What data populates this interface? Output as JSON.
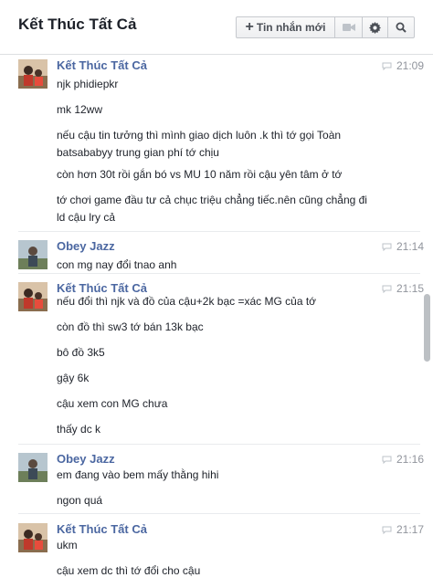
{
  "header": {
    "title": "Kết Thúc Tất Cả",
    "new_message_label": "Tin nhắn mới",
    "icons": [
      "plus-icon",
      "video-icon",
      "gear-icon",
      "search-icon"
    ]
  },
  "colors": {
    "sender": "#4b67a1",
    "time": "#90949c",
    "text": "#1d2129"
  },
  "groups": [
    {
      "sender": "Kết Thúc Tất Cả",
      "time": "21:09",
      "messages": [
        "njk phidiepkr",
        "mk 12ww",
        "nếu cậu tin tưởng thì mình giao dịch luôn .k thì tớ gọi Toàn batsababyy trung gian phí tớ chịu",
        "còn hơn 30t rồi gắn bó vs MU 10 năm rồi cậu yên tâm ở tớ",
        "tớ chơi game đầu tư cả chục triệu chẳng tiếc.nên cũng chẳng đi ld cậu lry cả"
      ]
    },
    {
      "sender": "Obey Jazz",
      "time": "21:14",
      "messages": [
        "con mg nay đổi tnao anh"
      ]
    },
    {
      "sender": "Kết Thúc Tất Cả",
      "time": "21:15",
      "messages": [
        "nếu đổi thì njk và đồ của cậu+2k bạc =xác MG của tớ",
        "còn đồ thì sw3 tớ bán 13k bạc",
        "bô đồ 3k5",
        "gậy 6k",
        "cậu xem con MG chưa",
        "thấy dc k"
      ]
    },
    {
      "sender": "Obey Jazz",
      "time": "21:16",
      "messages": [
        "em đang vào bem mấy thằng hihi",
        "ngon quá"
      ]
    },
    {
      "sender": "Kết Thúc Tất Cả",
      "time": "21:17",
      "messages": [
        "ukm",
        "cậu xem dc thì tớ đổi cho cậu"
      ]
    }
  ]
}
